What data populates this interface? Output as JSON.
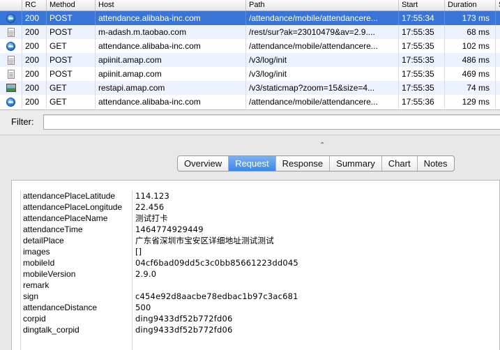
{
  "request_table": {
    "columns": [
      "RC",
      "Method",
      "Host",
      "Path",
      "Start",
      "Duration",
      "S"
    ],
    "rows": [
      {
        "icon": "globe-icon",
        "rc": "200",
        "method": "POST",
        "host": "attendance.alibaba-inc.com",
        "path": "/attendance/mobile/attendancere...",
        "start": "17:55:34",
        "duration": "173 ms",
        "selected": true
      },
      {
        "icon": "document-icon",
        "rc": "200",
        "method": "POST",
        "host": "m-adash.m.taobao.com",
        "path": "/rest/sur?ak=23010479&av=2.9....",
        "start": "17:55:35",
        "duration": "68 ms",
        "selected": false
      },
      {
        "icon": "globe-icon",
        "rc": "200",
        "method": "GET",
        "host": "attendance.alibaba-inc.com",
        "path": "/attendance/mobile/attendancere...",
        "start": "17:55:35",
        "duration": "102 ms",
        "selected": false
      },
      {
        "icon": "document-icon",
        "rc": "200",
        "method": "POST",
        "host": "apiinit.amap.com",
        "path": "/v3/log/init",
        "start": "17:55:35",
        "duration": "486 ms",
        "selected": false
      },
      {
        "icon": "document-icon",
        "rc": "200",
        "method": "POST",
        "host": "apiinit.amap.com",
        "path": "/v3/log/init",
        "start": "17:55:35",
        "duration": "469 ms",
        "selected": false
      },
      {
        "icon": "image-icon",
        "rc": "200",
        "method": "GET",
        "host": "restapi.amap.com",
        "path": "/v3/staticmap?zoom=15&size=4...",
        "start": "17:55:35",
        "duration": "74 ms",
        "selected": false
      },
      {
        "icon": "globe-icon",
        "rc": "200",
        "method": "GET",
        "host": "attendance.alibaba-inc.com",
        "path": "/attendance/mobile/attendancere...",
        "start": "17:55:36",
        "duration": "129 ms",
        "selected": false
      }
    ]
  },
  "filter": {
    "label": "Filter:",
    "value": "",
    "placeholder": ""
  },
  "tabs": [
    {
      "label": "Overview",
      "active": false
    },
    {
      "label": "Request",
      "active": true
    },
    {
      "label": "Response",
      "active": false
    },
    {
      "label": "Summary",
      "active": false
    },
    {
      "label": "Chart",
      "active": false
    },
    {
      "label": "Notes",
      "active": false
    }
  ],
  "split_handle": "⌃",
  "params": [
    {
      "key": "attendancePlaceLatitude",
      "value": "114.123"
    },
    {
      "key": "attendancePlaceLongitude",
      "value": "22.456"
    },
    {
      "key": "attendancePlaceName",
      "value": "测试打卡"
    },
    {
      "key": "attendanceTime",
      "value": "1464774929449"
    },
    {
      "key": "detailPlace",
      "value": "广东省深圳市宝安区详细地址测试测试"
    },
    {
      "key": "images",
      "value": "[]"
    },
    {
      "key": "mobileId",
      "value": "04cf6bad09dd5c3c0bb85661223dd045"
    },
    {
      "key": "mobileVersion",
      "value": "2.9.0"
    },
    {
      "key": "remark",
      "value": ""
    },
    {
      "key": "sign",
      "value": "c454e92d8aacbe78edbac1b97c3ac681"
    },
    {
      "key": "attendanceDistance",
      "value": "500"
    },
    {
      "key": "corpid",
      "value": "ding9433df52b772fd06"
    },
    {
      "key": "dingtalk_corpid",
      "value": "ding9433df52b772fd06"
    }
  ],
  "colors": {
    "selection": "#3875d7",
    "alt_row": "#edf3fe",
    "active_tab": "#3d86e6"
  }
}
